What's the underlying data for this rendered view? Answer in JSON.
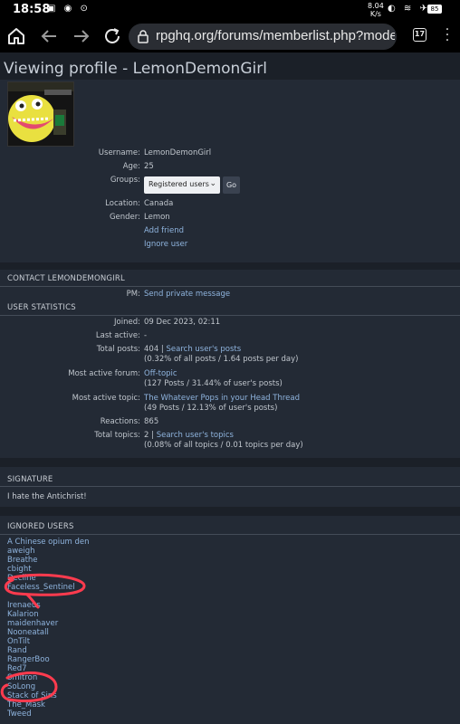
{
  "status_bar": {
    "time": "18:58",
    "rate_value": "8.04",
    "rate_unit": "K/s",
    "battery": "85"
  },
  "browser": {
    "url": "rpghq.org/forums/memberlist.php?mode=viewprofile",
    "tab_count": "17"
  },
  "page": {
    "title": "Viewing profile - LemonDemonGirl"
  },
  "profile": {
    "username_label": "Username:",
    "username": "LemonDemonGirl",
    "age_label": "Age:",
    "age": "25",
    "groups_label": "Groups:",
    "groups_selected": "Registered users",
    "go_label": "Go",
    "location_label": "Location:",
    "location": "Canada",
    "gender_label": "Gender:",
    "gender": "Lemon",
    "add_friend": "Add friend",
    "ignore_user": "Ignore user"
  },
  "contact": {
    "heading": "CONTACT LEMONDEMONGIRL",
    "pm_label": "PM:",
    "pm_link": "Send private message"
  },
  "stats": {
    "heading": "USER STATISTICS",
    "joined_label": "Joined:",
    "joined": "09 Dec 2023, 02:11",
    "last_active_label": "Last active:",
    "last_active": "-",
    "total_posts_label": "Total posts:",
    "total_posts": "404 |",
    "search_posts": "Search user's posts",
    "total_posts_sub": "(0.32% of all posts / 1.64 posts per day)",
    "active_forum_label": "Most active forum:",
    "active_forum": "Off-topic",
    "active_forum_sub": "(127 Posts / 31.44% of user's posts)",
    "active_topic_label": "Most active topic:",
    "active_topic": "The Whatever Pops in your Head Thread",
    "active_topic_sub": "(49 Posts / 12.13% of user's posts)",
    "reactions_label": "Reactions:",
    "reactions": "865",
    "total_topics_label": "Total topics:",
    "total_topics": "2 |",
    "search_topics": "Search user's topics",
    "total_topics_sub": "(0.08% of all topics / 0.01 topics per day)"
  },
  "signature": {
    "heading": "SIGNATURE",
    "text": "I hate the Antichrist!"
  },
  "ignored": {
    "heading": "IGNORED USERS",
    "users": [
      "A Chinese opium den",
      "aweigh",
      "Breathe",
      "cbight",
      "Decline",
      "Faceless_Sentinel",
      "",
      "Irenaeus",
      "Kalarion",
      "maidenhaver",
      "Nooneatall",
      "OnTilt",
      "Rand",
      "RangerBoo",
      "Red7",
      "Smitron",
      "SoLong",
      "Stack of Sins",
      "The_Mask",
      "Tweed"
    ]
  },
  "colors": {
    "background": "#1b2028",
    "panel": "#232a35",
    "link": "#8fb4de",
    "annotation_red": "#ff3b4e"
  }
}
